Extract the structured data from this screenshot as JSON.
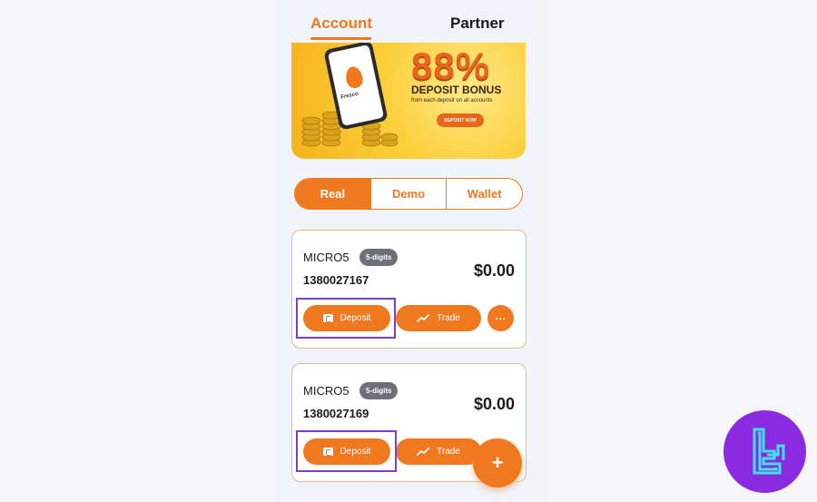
{
  "top_tabs": {
    "account": "Account",
    "partner": "Partner"
  },
  "banner": {
    "headline": "88%",
    "title": "DEPOSIT BONUS",
    "subtitle": "from each deposit on all accounts",
    "cta": "DEPOSIT NOW",
    "phone_brand": "Fresco"
  },
  "segment": {
    "items": [
      "Real",
      "Demo",
      "Wallet"
    ],
    "selected": "Real"
  },
  "accounts": [
    {
      "type": "MICRO5",
      "badge": "5-digits",
      "number": "1380027167",
      "balance": "$0.00",
      "deposit": "Deposit",
      "trade": "Trade",
      "more": "···"
    },
    {
      "type": "MICRO5",
      "badge": "5-digits",
      "number": "1380027169",
      "balance": "$0.00",
      "deposit": "Deposit",
      "trade": "Trade"
    }
  ],
  "fab": {
    "label": "+"
  },
  "colors": {
    "accent": "#f0781e",
    "highlight": "#7b3fd0",
    "logo": "#8a2be2"
  },
  "icons": {
    "wallet": "wallet-icon",
    "trend": "trend-up-icon",
    "more": "more-horizontal-icon",
    "add": "plus-icon"
  }
}
